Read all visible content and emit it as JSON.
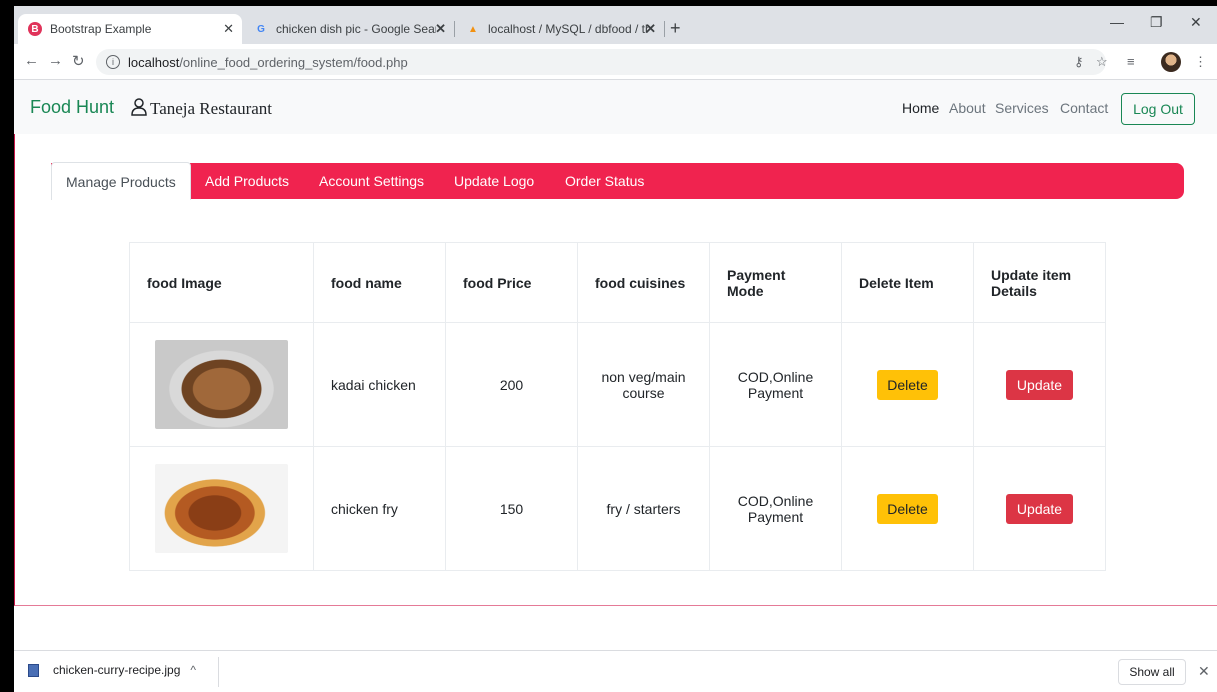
{
  "browser": {
    "tabs": [
      {
        "title": "Bootstrap Example",
        "active": true
      },
      {
        "title": "chicken dish pic - Google Search",
        "active": false
      },
      {
        "title": "localhost / MySQL / dbfood / tba",
        "active": false
      }
    ],
    "new_tab": "+",
    "tab_close": "✕",
    "url_host": "localhost",
    "url_path": "/online_food_ordering_system/food.php"
  },
  "navbar": {
    "brand": "Food Hunt",
    "restaurant": "Taneja Restaurant",
    "links": [
      "Home",
      "About",
      "Services",
      "Contact"
    ],
    "logout": "Log Out"
  },
  "panel_tabs": [
    "Manage Products",
    "Add Products",
    "Account Settings",
    "Update Logo",
    "Order Status"
  ],
  "table": {
    "headers": [
      "food Image",
      "food name",
      "food Price",
      "food cuisines",
      "Payment Mode",
      "Delete Item",
      "Update item Details"
    ],
    "rows": [
      {
        "name": "kadai chicken",
        "price": "200",
        "cuisine": "non veg/main course",
        "payment": "COD,Online Payment",
        "delete": "Delete",
        "update": "Update"
      },
      {
        "name": "chicken fry",
        "price": "150",
        "cuisine": "fry / starters",
        "payment": "COD,Online Payment",
        "delete": "Delete",
        "update": "Update"
      }
    ]
  },
  "downloads": {
    "file": "chicken-curry-recipe.jpg",
    "chevron": "^",
    "show_all": "Show all",
    "close": "✕"
  },
  "colors": {
    "brand": "#198754",
    "tabs_bar": "#f0234f",
    "delete_button": "#ffc107",
    "update_button": "#dc3545"
  }
}
